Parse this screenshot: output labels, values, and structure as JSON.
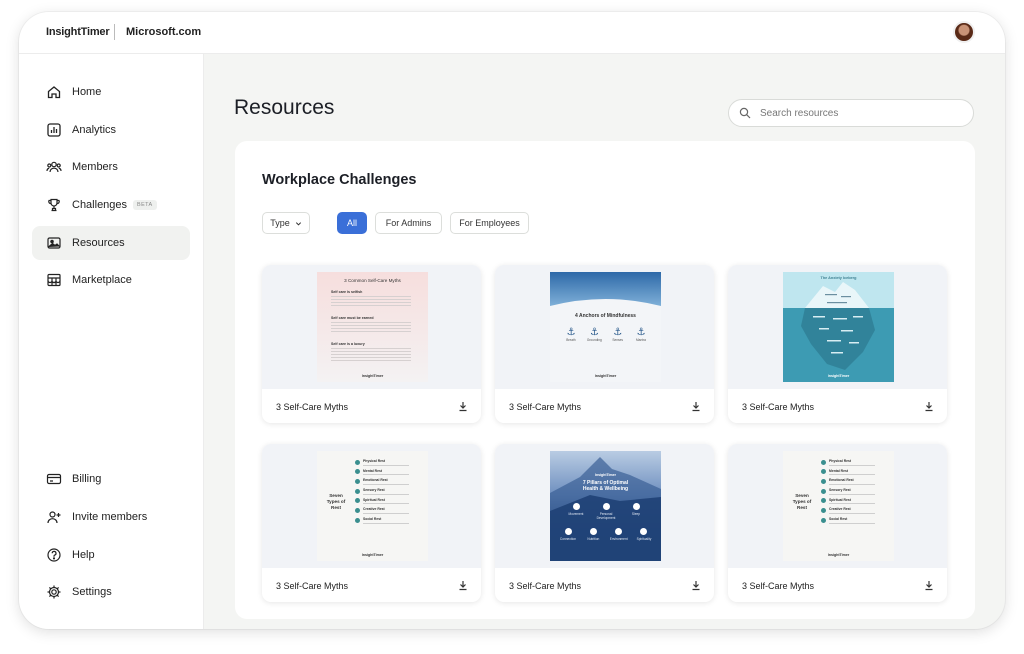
{
  "header": {
    "brand": "InsightTimer",
    "org": "Microsoft.com"
  },
  "sidebar": {
    "items": [
      {
        "label": "Home",
        "icon": "home-icon"
      },
      {
        "label": "Analytics",
        "icon": "chart-icon"
      },
      {
        "label": "Members",
        "icon": "users-icon"
      },
      {
        "label": "Challenges",
        "icon": "trophy-icon",
        "badge": "BETA"
      },
      {
        "label": "Resources",
        "icon": "image-icon",
        "active": true
      },
      {
        "label": "Marketplace",
        "icon": "store-icon"
      }
    ],
    "bottom_items": [
      {
        "label": "Billing",
        "icon": "card-icon"
      },
      {
        "label": "Invite members",
        "icon": "user-plus-icon"
      },
      {
        "label": "Help",
        "icon": "help-icon"
      },
      {
        "label": "Settings",
        "icon": "gear-icon"
      }
    ]
  },
  "main": {
    "title": "Resources",
    "search_placeholder": "Search resources",
    "section_title": "Workplace Challenges",
    "filters": {
      "type_label": "Type",
      "chips": [
        "All",
        "For Admins",
        "For Employees"
      ],
      "active_chip": "All"
    },
    "cards": [
      {
        "label": "3 Self-Care Myths"
      },
      {
        "label": "3 Self-Care Myths"
      },
      {
        "label": "3 Self-Care Myths"
      },
      {
        "label": "3 Self-Care Myths"
      },
      {
        "label": "3 Self-Care Myths"
      },
      {
        "label": "3 Self-Care Myths"
      }
    ]
  },
  "posters": {
    "myths": {
      "title": "3 Common Self-Care Myths",
      "items": [
        "Self care is selfish",
        "Self care must be earned",
        "Self care is a luxury"
      ],
      "logo": "InsightTimer"
    },
    "anchors": {
      "title": "4 Anchors of Mindfulness",
      "items": [
        "Breath",
        "Grounding",
        "Senses",
        "Mantra"
      ],
      "logo": "InsightTimer"
    },
    "iceberg": {
      "title": "The Anxiety Iceberg",
      "logo": "InsightTimer"
    },
    "rest": {
      "title_lines": [
        "Seven",
        "Types of",
        "Rest"
      ],
      "items": [
        "Physical Rest",
        "Mental Rest",
        "Emotional Rest",
        "Sensory Rest",
        "Spiritual Rest",
        "Creative Rest",
        "Social Rest"
      ],
      "logo": "InsightTimer"
    },
    "pillars": {
      "brand": "InsightTimer",
      "title_lines": [
        "7 Pillars of Optimal",
        "Health & Wellbeing"
      ],
      "row1": [
        "Movement",
        "Personal Development",
        "Sleep"
      ],
      "row2": [
        "Connection",
        "Nutrition",
        "Environment",
        "Spirituality"
      ]
    }
  },
  "colors": {
    "accent": "#3a6fd8",
    "sidebar_active": "#f1f2f0",
    "teal": "#3a8f8f",
    "navy": "#1e3f75"
  }
}
